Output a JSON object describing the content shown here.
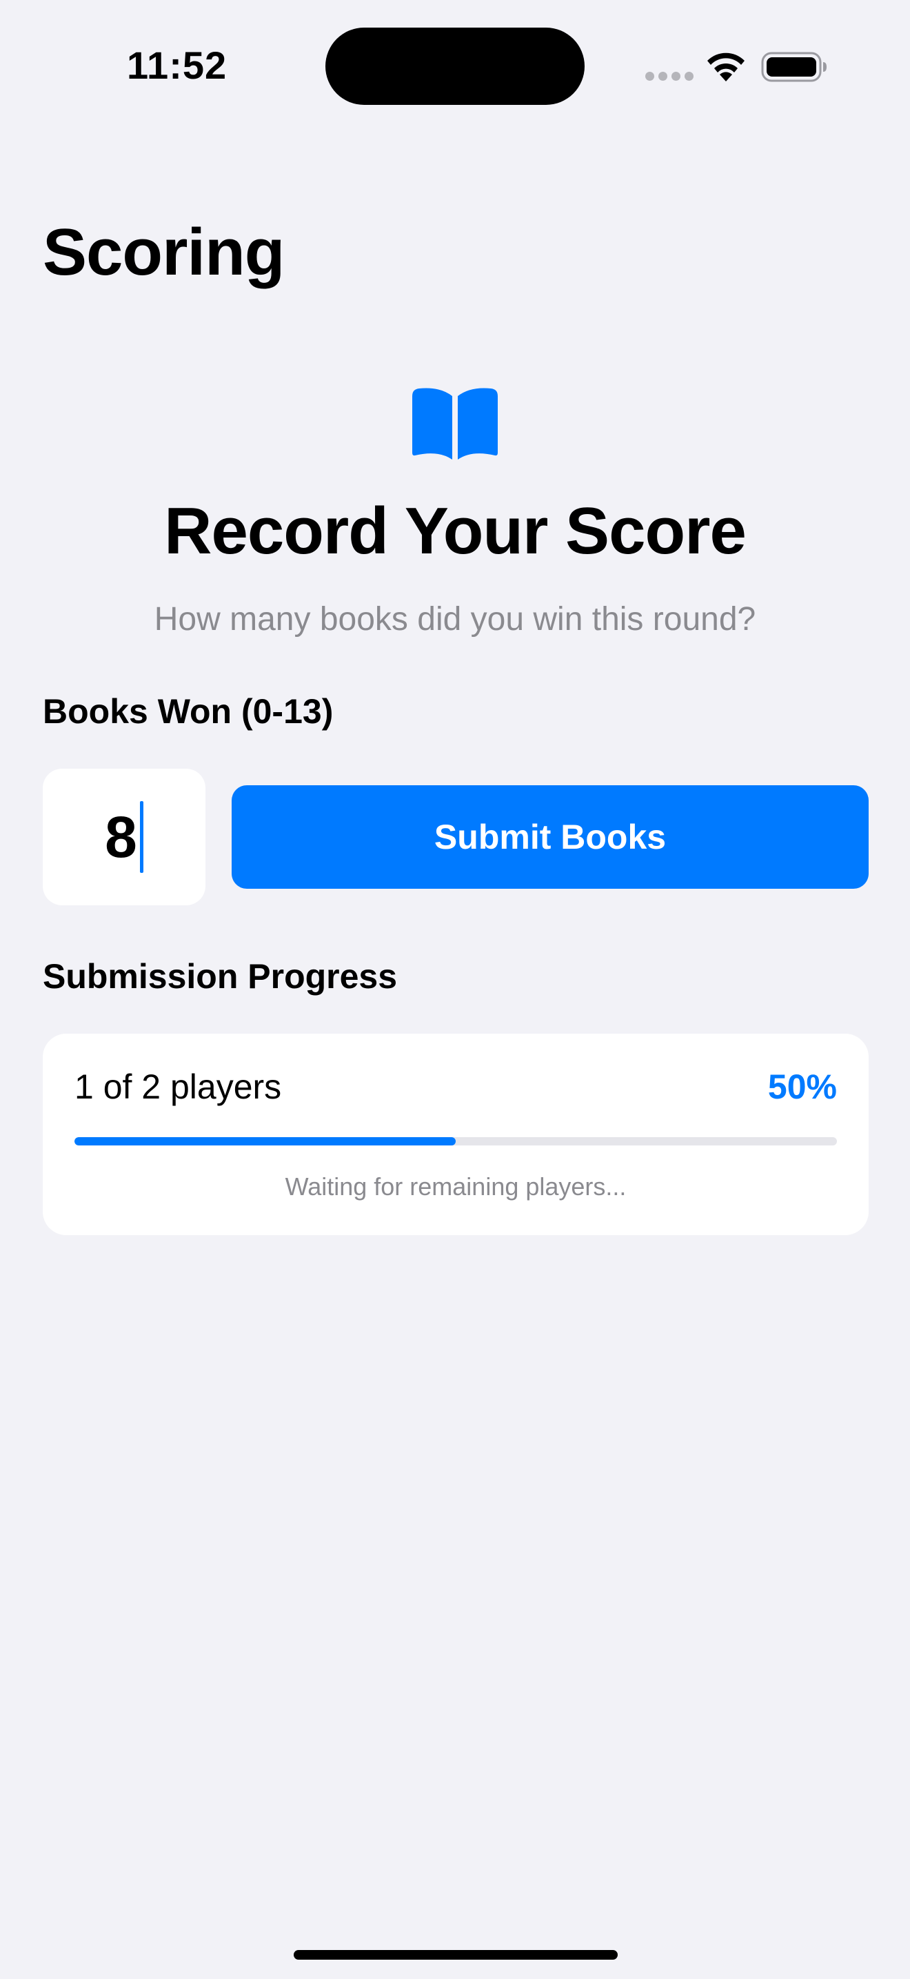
{
  "status_bar": {
    "time": "11:52"
  },
  "header": {
    "title": "Scoring"
  },
  "hero": {
    "icon": "book-icon",
    "heading": "Record Your Score",
    "subtitle": "How many books did you win this round?"
  },
  "form": {
    "field_label": "Books Won (0-13)",
    "books_value": "8",
    "submit_label": "Submit Books"
  },
  "progress": {
    "section_label": "Submission Progress",
    "count_text": "1 of 2 players",
    "percent_text": "50%",
    "fraction": 0.5,
    "status_text": "Waiting for remaining players..."
  },
  "colors": {
    "accent": "#007aff",
    "background": "#f2f2f7",
    "secondary_text": "#8a8a8f"
  }
}
